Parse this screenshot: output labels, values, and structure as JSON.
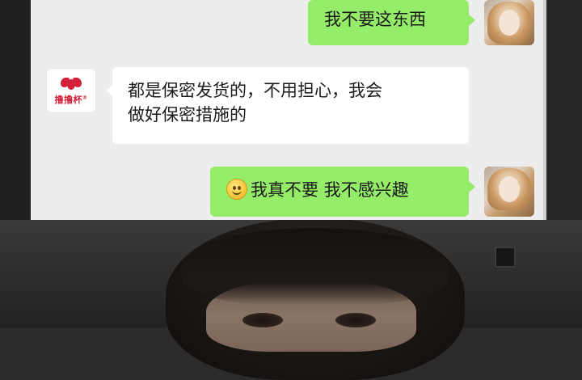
{
  "chat": {
    "messages": [
      {
        "side": "out",
        "sender": "user",
        "text": "我不要这东西"
      },
      {
        "side": "in",
        "sender": "merchant",
        "lines": [
          "都是保密发货的，不用担心，我会",
          "做好保密措施的"
        ]
      },
      {
        "side": "out",
        "sender": "user",
        "emoji": "slightly-smiling-face-icon",
        "text": "我真不要 我不感兴趣"
      }
    ]
  },
  "merchant_avatar": {
    "brand": "撸撸杯",
    "mark": "®",
    "color": "#d4213a"
  },
  "colors": {
    "chat_bg": "#ededed",
    "outgoing_bubble": "#95ec69",
    "incoming_bubble": "#ffffff"
  }
}
